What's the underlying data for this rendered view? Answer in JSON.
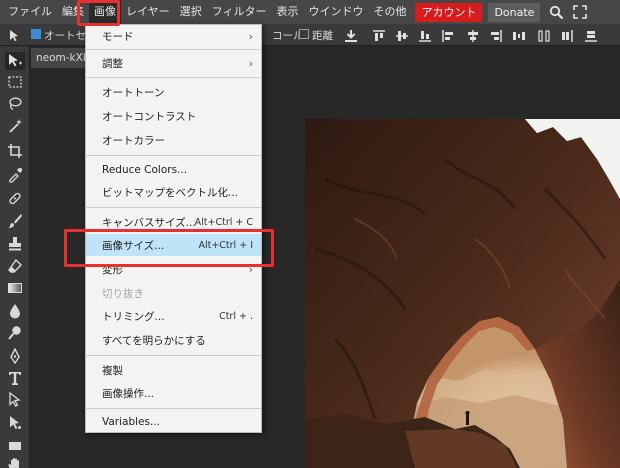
{
  "menubar": {
    "items": [
      "ファイル",
      "編集",
      "画像",
      "レイヤー",
      "選択",
      "フィルター",
      "表示",
      "ウインドウ",
      "その他"
    ],
    "account": "アカウント",
    "donate": "Donate"
  },
  "options": {
    "autoselect": "オートセ",
    "control": "コール",
    "distance": "距離"
  },
  "document": {
    "tab": "neom-kXbit"
  },
  "dropdown": {
    "mode": "モード",
    "adjust": "調整",
    "auto_tone": "オートトーン",
    "auto_contrast": "オートコントラスト",
    "auto_color": "オートカラー",
    "reduce_colors": "Reduce Colors...",
    "bitmap_vector": "ビットマップをベクトル化...",
    "canvas_size": "キャンバスサイズ...",
    "canvas_size_sc": "Alt+Ctrl + C",
    "image_size": "画像サイズ...",
    "image_size_sc": "Alt+Ctrl + I",
    "transform": "変形",
    "crop": "切り抜き",
    "trim": "トリミング...",
    "trim_sc": "Ctrl + .",
    "reveal_all": "すべてを明らかにする",
    "duplicate": "複製",
    "apply_image": "画像操作...",
    "variables": "Variables..."
  },
  "colors": {
    "accent_red": "#e83030",
    "highlight": "#bfe3f7",
    "account_red": "#d61c1c"
  }
}
